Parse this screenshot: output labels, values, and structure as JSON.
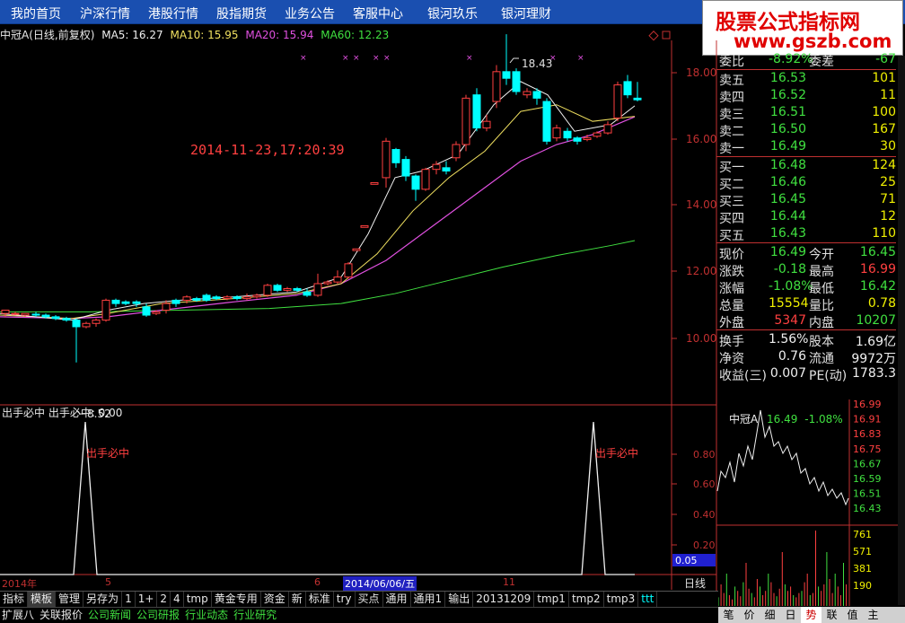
{
  "menu": [
    "我的首页",
    "沪深行情",
    "港股行情",
    "股指期货",
    "业务公告",
    "客服中心",
    "银河玖乐",
    "银河理财"
  ],
  "brand": {
    "line1": "股票公式指标网",
    "line2": "www.gszb.com"
  },
  "legend": {
    "title": "中冠A(日线,前复权)",
    "ma5": "MA5: 16.27",
    "ma10": "MA10: 15.95",
    "ma20": "MA20: 15.94",
    "ma60": "MA60: 12.23"
  },
  "main": {
    "price_axis": [
      "18.00",
      "16.00",
      "14.00",
      "12.00",
      "10.00"
    ],
    "high_label": "18.43",
    "low_label": "8.52",
    "timestamp": "2014-11-23,17:20:39"
  },
  "indicator": {
    "title": "出手必中  出手必中: 0.00",
    "signal_label": "出手必中",
    "axis": [
      "0.80",
      "0.60",
      "0.40",
      "0.20"
    ],
    "value_box": "0.05",
    "period": "日线"
  },
  "dates": {
    "year": "2014年",
    "m5": "5",
    "m6": "6",
    "cursor": "2014/06/06/五",
    "m11": "11"
  },
  "quote": {
    "wei": {
      "k": "委比",
      "v": "-8.92%",
      "k2": "委差",
      "v2": "-67"
    },
    "sell": [
      {
        "k": "卖五",
        "p": "16.53",
        "q": "101"
      },
      {
        "k": "卖四",
        "p": "16.52",
        "q": "11"
      },
      {
        "k": "卖三",
        "p": "16.51",
        "q": "100"
      },
      {
        "k": "卖二",
        "p": "16.50",
        "q": "167"
      },
      {
        "k": "卖一",
        "p": "16.49",
        "q": "30"
      }
    ],
    "buy": [
      {
        "k": "买一",
        "p": "16.48",
        "q": "124"
      },
      {
        "k": "买二",
        "p": "16.46",
        "q": "25"
      },
      {
        "k": "买三",
        "p": "16.45",
        "q": "71"
      },
      {
        "k": "买四",
        "p": "16.44",
        "q": "12"
      },
      {
        "k": "买五",
        "p": "16.43",
        "q": "110"
      }
    ],
    "stats1": [
      {
        "k": "现价",
        "v": "16.49",
        "vc": "green",
        "k2": "今开",
        "v2": "16.45",
        "v2c": "green"
      },
      {
        "k": "涨跌",
        "v": "-0.18",
        "vc": "green",
        "k2": "最高",
        "v2": "16.99",
        "v2c": "red"
      },
      {
        "k": "涨幅",
        "v": "-1.08%",
        "vc": "green",
        "k2": "最低",
        "v2": "16.42",
        "v2c": "green"
      },
      {
        "k": "总量",
        "v": "15554",
        "vc": "yellow",
        "k2": "量比",
        "v2": "0.78",
        "v2c": "yellow"
      },
      {
        "k": "外盘",
        "v": "5347",
        "vc": "red",
        "k2": "内盘",
        "v2": "10207",
        "v2c": "green"
      }
    ],
    "stats2": [
      {
        "k": "换手",
        "v": "1.56%",
        "k2": "股本",
        "v2": "1.69亿"
      },
      {
        "k": "净资",
        "v": "0.76",
        "k2": "流通",
        "v2": "9972万"
      },
      {
        "k": "收益(三)",
        "v": "0.007",
        "k2": "PE(动)",
        "v2": "1783.3"
      }
    ]
  },
  "mini": {
    "name": "中冠A",
    "price": "16.49",
    "pct": "-1.08%",
    "price_axis": [
      "16.99",
      "16.91",
      "16.83",
      "16.75",
      "16.67",
      "16.59",
      "16.51",
      "16.43"
    ],
    "vol_axis": [
      "761",
      "571",
      "381",
      "190"
    ]
  },
  "toolbar": [
    "指标",
    "模板",
    "管理",
    "另存为",
    "1",
    "1+",
    "2",
    "4",
    "tmp",
    "黄金专用",
    "资金",
    "新",
    "标准",
    "try",
    "买点",
    "通用",
    "通用1",
    "输出",
    "20131209",
    "tmp1",
    "tmp2",
    "tmp3",
    "ttt"
  ],
  "tabs": [
    "扩展八",
    "关联报价",
    "公司新闻",
    "公司研报",
    "行业动态",
    "行业研究"
  ],
  "rtabs": [
    "笔",
    "价",
    "细",
    "日",
    "势",
    "联",
    "值",
    "主"
  ],
  "colors": {
    "up": "#ff4040",
    "down": "#00ffff",
    "ma5": "#f0f0f0",
    "ma10": "#f0e060",
    "ma20": "#e050e0",
    "ma60": "#40e040",
    "axis": "#c03030"
  }
}
